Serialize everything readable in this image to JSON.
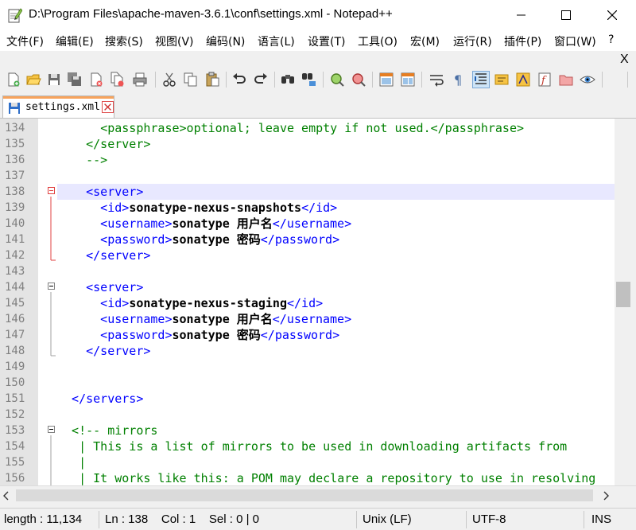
{
  "window": {
    "title": "D:\\Program Files\\apache-maven-3.6.1\\conf\\settings.xml - Notepad++",
    "minimize_icon": "minimize-icon",
    "maximize_icon": "maximize-icon",
    "close_icon": "close-icon"
  },
  "menu": {
    "items": [
      "文件(F)",
      "编辑(E)",
      "搜索(S)",
      "视图(V)",
      "编码(N)",
      "语言(L)",
      "设置(T)",
      "工具(O)",
      "宏(M)",
      "运行(R)",
      "插件(P)",
      "窗口(W)",
      "?"
    ],
    "close_doc": "X"
  },
  "toolbar": {
    "icons": [
      "new-file-icon",
      "open-file-icon",
      "save-icon",
      "save-all-icon",
      "close-icon",
      "close-all-icon",
      "print-icon",
      "cut-icon",
      "copy-icon",
      "paste-icon",
      "undo-icon",
      "redo-icon",
      "find-icon",
      "replace-icon",
      "zoom-in-icon",
      "zoom-out-icon",
      "sync-vertical-icon",
      "sync-horizontal-icon",
      "word-wrap-icon",
      "show-all-chars-icon",
      "indent-guide-icon",
      "doc-map-icon",
      "function-list-icon",
      "folder-workspace-icon",
      "monitor-icon",
      "record-macro-icon",
      "eye-icon"
    ]
  },
  "tabs": [
    {
      "label": "settings.xml",
      "active": true,
      "icon": "save-icon"
    }
  ],
  "editor": {
    "current_line": "138",
    "lines": [
      {
        "n": "134",
        "parts": [
          {
            "t": "      ",
            "c": "cmt"
          },
          {
            "t": "<passphrase>optional; leave empty if not used.</passphrase>",
            "c": "cmt"
          }
        ]
      },
      {
        "n": "135",
        "parts": [
          {
            "t": "    </server>",
            "c": "cmt"
          }
        ]
      },
      {
        "n": "136",
        "parts": [
          {
            "t": "    -->",
            "c": "cmt"
          }
        ]
      },
      {
        "n": "137",
        "parts": []
      },
      {
        "n": "138",
        "parts": [
          {
            "t": "    <server>",
            "c": "tag"
          }
        ]
      },
      {
        "n": "139",
        "parts": [
          {
            "t": "      <id>",
            "c": "tag"
          },
          {
            "t": "sonatype-nexus-snapshots",
            "c": "val"
          },
          {
            "t": "</id>",
            "c": "tag"
          }
        ]
      },
      {
        "n": "140",
        "parts": [
          {
            "t": "      <username>",
            "c": "tag"
          },
          {
            "t": "sonatype 用户名",
            "c": "val"
          },
          {
            "t": "</username>",
            "c": "tag"
          }
        ]
      },
      {
        "n": "141",
        "parts": [
          {
            "t": "      <password>",
            "c": "tag"
          },
          {
            "t": "sonatype 密码",
            "c": "val"
          },
          {
            "t": "</password>",
            "c": "tag"
          }
        ]
      },
      {
        "n": "142",
        "parts": [
          {
            "t": "    </server>",
            "c": "tag"
          }
        ]
      },
      {
        "n": "143",
        "parts": []
      },
      {
        "n": "144",
        "parts": [
          {
            "t": "    <server>",
            "c": "tag"
          }
        ]
      },
      {
        "n": "145",
        "parts": [
          {
            "t": "      <id>",
            "c": "tag"
          },
          {
            "t": "sonatype-nexus-staging",
            "c": "val"
          },
          {
            "t": "</id>",
            "c": "tag"
          }
        ]
      },
      {
        "n": "146",
        "parts": [
          {
            "t": "      <username>",
            "c": "tag"
          },
          {
            "t": "sonatype 用户名",
            "c": "val"
          },
          {
            "t": "</username>",
            "c": "tag"
          }
        ]
      },
      {
        "n": "147",
        "parts": [
          {
            "t": "      <password>",
            "c": "tag"
          },
          {
            "t": "sonatype 密码",
            "c": "val"
          },
          {
            "t": "</password>",
            "c": "tag"
          }
        ]
      },
      {
        "n": "148",
        "parts": [
          {
            "t": "    </server>",
            "c": "tag"
          }
        ]
      },
      {
        "n": "149",
        "parts": []
      },
      {
        "n": "150",
        "parts": []
      },
      {
        "n": "151",
        "parts": [
          {
            "t": "  </servers>",
            "c": "tag"
          }
        ]
      },
      {
        "n": "152",
        "parts": []
      },
      {
        "n": "153",
        "parts": [
          {
            "t": "  <!-- mirrors",
            "c": "cmt"
          }
        ]
      },
      {
        "n": "154",
        "parts": [
          {
            "t": "   | This is a list of mirrors to be used in downloading artifacts from",
            "c": "cmt"
          }
        ]
      },
      {
        "n": "155",
        "parts": [
          {
            "t": "   |",
            "c": "cmt"
          }
        ]
      },
      {
        "n": "156",
        "parts": [
          {
            "t": "   | It works like this: a POM may declare a repository to use in resolving",
            "c": "cmt"
          }
        ]
      }
    ]
  },
  "status": {
    "length": "length : 11,134",
    "position": "Ln : 138    Col : 1    Sel : 0 | 0",
    "eol": "Unix (LF)",
    "encoding": "UTF-8",
    "mode": "INS"
  }
}
